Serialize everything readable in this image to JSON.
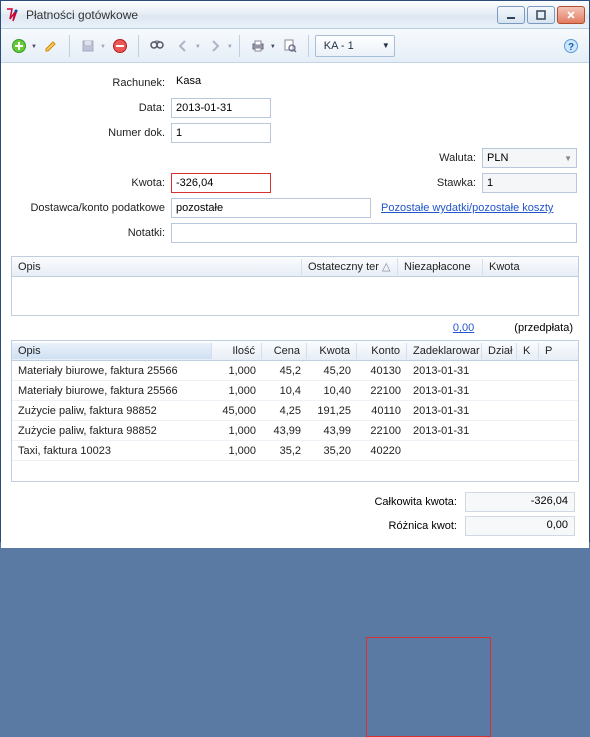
{
  "window": {
    "title": "Płatności gotówkowe"
  },
  "toolbar": {
    "combo": "KA - 1"
  },
  "form": {
    "rachunek_label": "Rachunek:",
    "rachunek": "Kasa",
    "data_label": "Data:",
    "data": "2013-01-31",
    "numer_label": "Numer dok.",
    "numer": "1",
    "waluta_label": "Waluta:",
    "waluta": "PLN",
    "kwota_label": "Kwota:",
    "kwota": "-326,04",
    "stawka_label": "Stawka:",
    "stawka": "1",
    "dostawca_label": "Dostawca/konto podatkowe",
    "dostawca": "pozostałe",
    "link": "Pozostałe wydatki/pozostałe koszty",
    "notatki_label": "Notatki:",
    "notatki": ""
  },
  "grid1": {
    "cols": {
      "opis": "Opis",
      "termin": "Ostateczny ter",
      "sort": "△",
      "niezaplacone": "Niezapłacone",
      "kwota": "Kwota"
    }
  },
  "prepay": {
    "amount": "0,00",
    "label": "(przedpłata)"
  },
  "grid2": {
    "cols": {
      "opis": "Opis",
      "ilosc": "Ilość",
      "cena": "Cena",
      "kwota": "Kwota",
      "konto": "Konto",
      "zadekl": "Zadeklarowar",
      "dzial": "Dział",
      "k": "K",
      "p": "P"
    },
    "rows": [
      {
        "opis": "Materiały biurowe, faktura 25566",
        "ilosc": "1,000",
        "cena": "45,2",
        "kwota": "45,20",
        "konto": "40130",
        "zadekl": "2013-01-31"
      },
      {
        "opis": "Materiały biurowe, faktura 25566",
        "ilosc": "1,000",
        "cena": "10,4",
        "kwota": "10,40",
        "konto": "22100",
        "zadekl": "2013-01-31"
      },
      {
        "opis": "Zużycie paliw, faktura 98852",
        "ilosc": "45,000",
        "cena": "4,25",
        "kwota": "191,25",
        "konto": "40110",
        "zadekl": "2013-01-31"
      },
      {
        "opis": "Zużycie paliw, faktura 98852",
        "ilosc": "1,000",
        "cena": "43,99",
        "kwota": "43,99",
        "konto": "22100",
        "zadekl": "2013-01-31"
      },
      {
        "opis": "Taxi, faktura 10023",
        "ilosc": "1,000",
        "cena": "35,2",
        "kwota": "35,20",
        "konto": "40220",
        "zadekl": ""
      }
    ]
  },
  "totals": {
    "calkowita_label": "Całkowita kwota:",
    "calkowita": "-326,04",
    "roznica_label": "Różnica kwot:",
    "roznica": "0,00"
  }
}
